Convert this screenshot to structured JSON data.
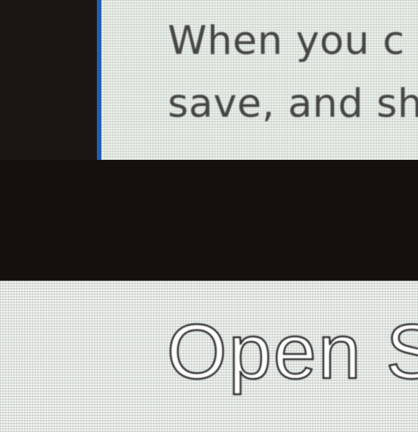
{
  "dialog": {
    "message_line_1": "When you c",
    "message_line_2": "save, and sh"
  },
  "panel": {
    "heading": "Open S"
  },
  "colors": {
    "accent": "#1f5fb8",
    "card_bg": "#e9efe9",
    "panel_bg": "#eef2ee",
    "background": "#17140f"
  }
}
